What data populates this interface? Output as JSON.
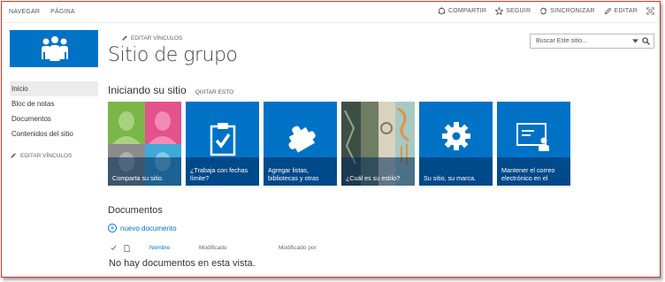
{
  "topbar": {
    "left": [
      "NAVEGAR",
      "PÁGINA"
    ],
    "actions": [
      {
        "label": "COMPARTIR",
        "icon": "share-icon"
      },
      {
        "label": "SEGUIR",
        "icon": "star-icon"
      },
      {
        "label": "SINCRONIZAR",
        "icon": "sync-icon"
      },
      {
        "label": "EDITAR",
        "icon": "pencil-icon"
      }
    ],
    "focus_icon": "focus-icon"
  },
  "header": {
    "edit_links": "EDITAR VÍNCULOS",
    "title": "Sitio de grupo",
    "search_placeholder": "Buscar Este sitio..."
  },
  "nav": {
    "items": [
      "Inicio",
      "Bloc de notas",
      "Documentos",
      "Contenidos del sitio"
    ],
    "active": "Inicio",
    "edit_links": "EDITAR VÍNCULOS"
  },
  "getting_started": {
    "title": "Iniciando su sitio",
    "remove": "QUITAR ESTO",
    "tiles": [
      {
        "caption": "Comparta su sitio.",
        "icon": "people-icon"
      },
      {
        "caption": "¿Trabaja con fechas límite?",
        "icon": "clipboard-check-icon"
      },
      {
        "caption": "Agregar listas, bibliotecas y otras",
        "icon": "puzzle-icon"
      },
      {
        "caption": "¿Cuál es su estilo?",
        "icon": "style-photo-icon"
      },
      {
        "caption": "Su sitio, su marca.",
        "icon": "gear-icon"
      },
      {
        "caption": "Mantener el correo electrónico en el",
        "icon": "mail-contact-icon"
      }
    ]
  },
  "documents": {
    "title": "Documentos",
    "new": "nuevo documento",
    "columns": [
      "Nombre",
      "Modificado",
      "Modificado por"
    ],
    "empty": "No hay documentos en esta vista."
  },
  "colors": {
    "accent": "#0072c6",
    "frame": "#c0392b"
  }
}
